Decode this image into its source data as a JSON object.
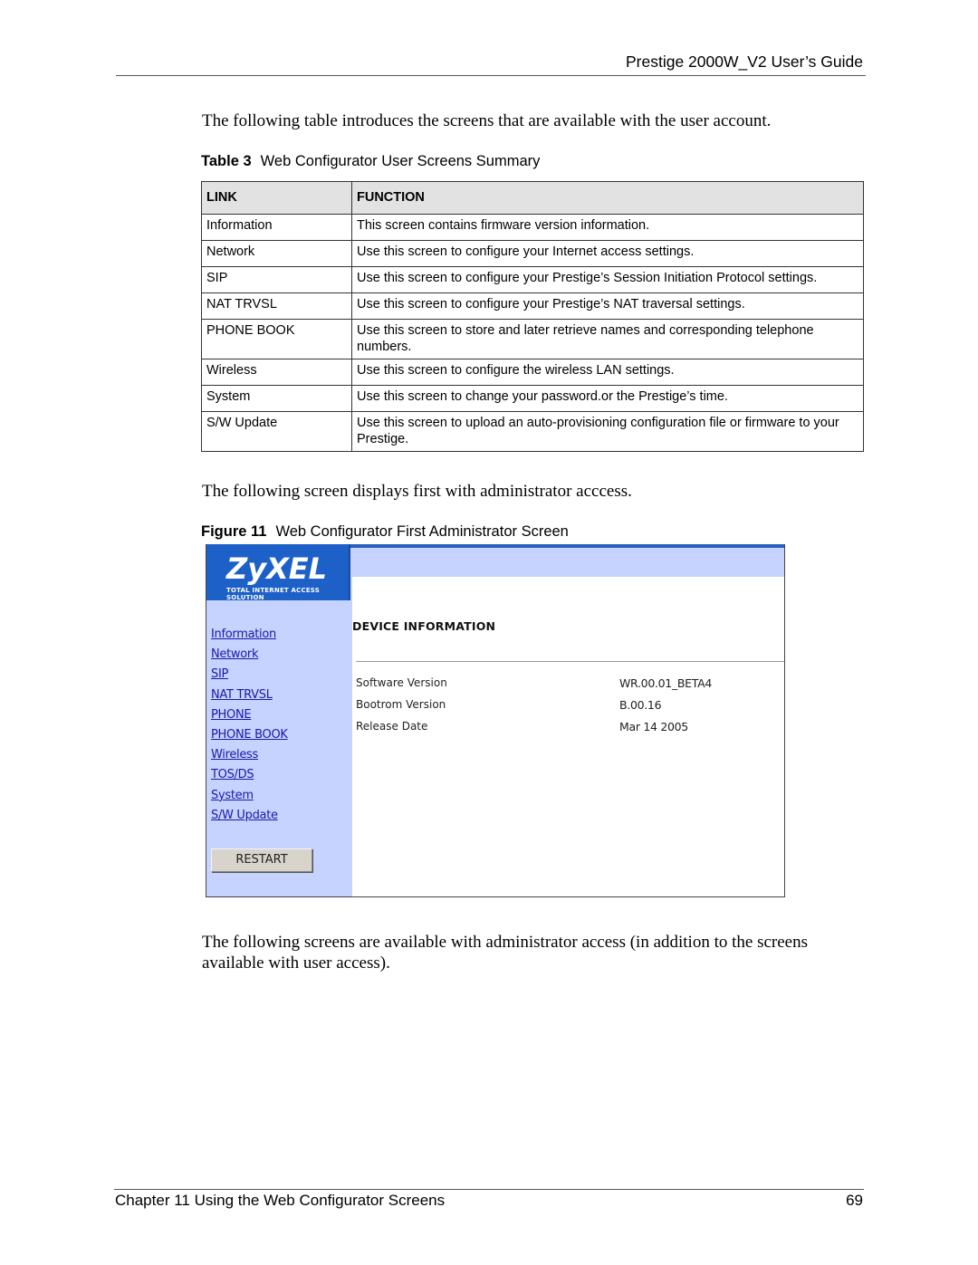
{
  "header": {
    "title": "Prestige 2000W_V2 User’s Guide"
  },
  "intro_paragraph": "The following table introduces the screens that are available with the user account.",
  "table": {
    "caption_label": "Table 3",
    "caption_title": "Web Configurator User Screens Summary",
    "columns": [
      "LINK",
      "FUNCTION"
    ],
    "rows": [
      {
        "link": "Information",
        "function": "This screen contains firmware version information."
      },
      {
        "link": "Network",
        "function": "Use this screen to configure your Internet access settings."
      },
      {
        "link": "SIP",
        "function": "Use this screen to configure your Prestige’s Session Initiation Protocol settings."
      },
      {
        "link": "NAT TRVSL",
        "function": "Use this screen to configure your Prestige’s NAT traversal settings."
      },
      {
        "link": "PHONE BOOK",
        "function": "Use this screen to store and later retrieve names and corresponding telephone numbers."
      },
      {
        "link": "Wireless",
        "function": "Use this screen to configure the wireless LAN settings."
      },
      {
        "link": "System",
        "function": "Use this screen to change your password.or the Prestige’s time."
      },
      {
        "link": "S/W Update",
        "function": "Use this screen to upload an auto-provisioning configuration file or firmware to your Prestige."
      }
    ]
  },
  "admin_paragraph": "The following screen displays first with administrator acccess.",
  "figure": {
    "caption_label": "Figure 11",
    "caption_title": "Web Configurator First Administrator Screen",
    "logo": {
      "brand": "ZyXEL",
      "tagline": "TOTAL INTERNET ACCESS SOLUTION"
    },
    "nav_links": [
      "Information",
      "Network",
      "SIP",
      "NAT TRVSL",
      "PHONE",
      "PHONE BOOK",
      "Wireless",
      "TOS/DS",
      "System",
      "S/W Update"
    ],
    "restart_label": "RESTART",
    "section_title": "DEVICE INFORMATION",
    "info": [
      {
        "label": "Software Version",
        "value": "WR.00.01_BETA4"
      },
      {
        "label": "Bootrom Version",
        "value": "B.00.16"
      },
      {
        "label": "Release Date",
        "value": "Mar 14 2005"
      }
    ],
    "colors": {
      "sidebar": "#c6d3ff",
      "logo_bg": "#1c60c8",
      "link": "#1a1aa8"
    }
  },
  "closing_paragraph": "The following screens are available with administrator access (in addition to the screens available with user access).",
  "footer": {
    "chapter": "Chapter 11 Using the Web Configurator Screens",
    "page_number": "69"
  }
}
